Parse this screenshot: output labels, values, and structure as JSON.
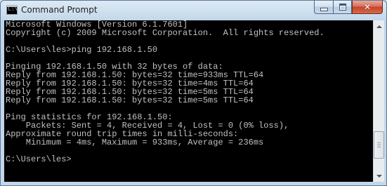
{
  "window": {
    "title": "Command Prompt",
    "app_icon_glyph": "C:\\",
    "icons": {
      "app": "command-prompt-icon",
      "minimize": "minimize-icon",
      "maximize": "maximize-icon",
      "close": "close-icon"
    },
    "colors": {
      "console_background": "#000000",
      "console_text": "#c0c0c0",
      "close_button": "#c4442a",
      "frame": "#c3d7ea"
    }
  },
  "console": {
    "lines": [
      "Microsoft Windows [Version 6.1.7601]",
      "Copyright (c) 2009 Microsoft Corporation.  All rights reserved.",
      "",
      "C:\\Users\\les>ping 192.168.1.50",
      "",
      "Pinging 192.168.1.50 with 32 bytes of data:",
      "Reply from 192.168.1.50: bytes=32 time=933ms TTL=64",
      "Reply from 192.168.1.50: bytes=32 time=4ms TTL=64",
      "Reply from 192.168.1.50: bytes=32 time=5ms TTL=64",
      "Reply from 192.168.1.50: bytes=32 time=5ms TTL=64",
      "",
      "Ping statistics for 192.168.1.50:",
      "    Packets: Sent = 4, Received = 4, Lost = 0 (0% loss),",
      "Approximate round trip times in milli-seconds:",
      "    Minimum = 4ms, Maximum = 933ms, Average = 236ms",
      "",
      "C:\\Users\\les>"
    ]
  },
  "scrollbar": {
    "position": 0.9,
    "visible_fraction": 0.2
  }
}
